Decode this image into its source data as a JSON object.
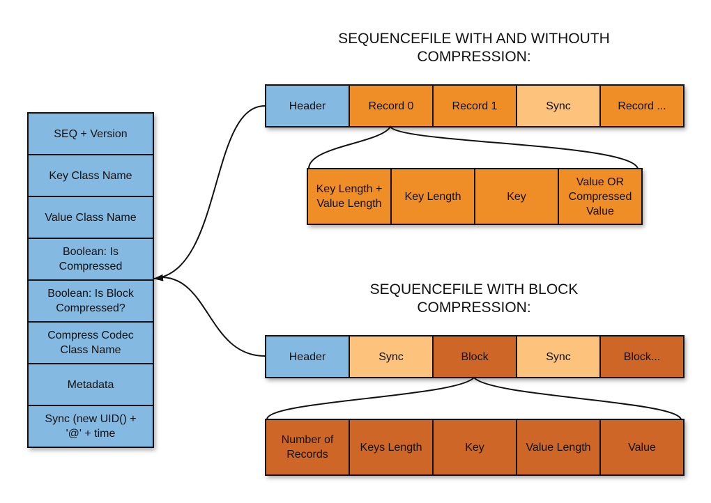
{
  "header_stack": {
    "items": [
      "SEQ + Version",
      "Key Class Name",
      "Value Class Name",
      "Boolean: Is\nCompressed",
      "Boolean: Is Block\nCompressed?",
      "Compress Codec\nClass Name",
      "Metadata",
      "Sync (new UID() +\n'@' + time"
    ]
  },
  "section_record": {
    "title": "SEQUENCEFILE WITH AND WITHOUTH\nCOMPRESSION:",
    "row": [
      {
        "label": "Header",
        "kind": "header"
      },
      {
        "label": "Record 0",
        "kind": "record"
      },
      {
        "label": "Record 1",
        "kind": "record"
      },
      {
        "label": "Sync",
        "kind": "sync"
      },
      {
        "label": "Record ...",
        "kind": "record"
      }
    ],
    "detail": [
      "Key Length +\nValue Length",
      "Key Length",
      "Key",
      "Value OR\nCompressed\nValue"
    ]
  },
  "section_block": {
    "title": "SEQUENCEFILE WITH BLOCK\nCOMPRESSION:",
    "row": [
      {
        "label": "Header",
        "kind": "header"
      },
      {
        "label": "Sync",
        "kind": "sync"
      },
      {
        "label": "Block",
        "kind": "block"
      },
      {
        "label": "Sync",
        "kind": "sync"
      },
      {
        "label": "Block...",
        "kind": "block"
      }
    ],
    "detail": [
      "Number of\nRecords",
      "Keys Length",
      "Key",
      "Value Length",
      "Value"
    ]
  },
  "colors": {
    "header": "#84b9e2",
    "record": "#ef8d27",
    "sync": "#fdc27b",
    "block": "#cd6627"
  }
}
